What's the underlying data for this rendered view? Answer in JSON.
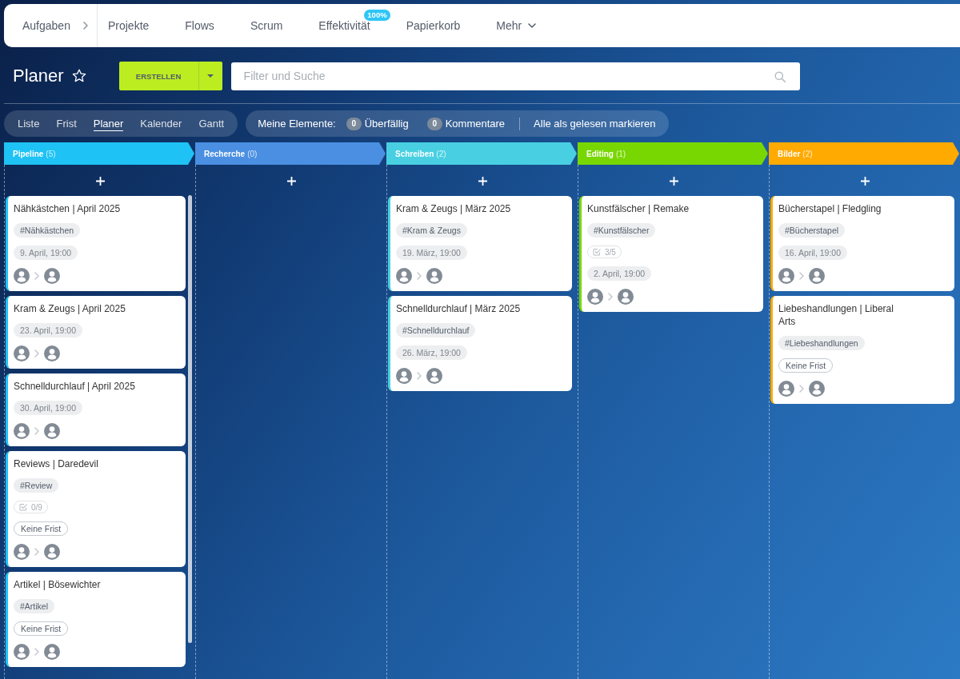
{
  "top_nav": {
    "items": [
      {
        "label": "Aufgaben",
        "kind": "section"
      },
      {
        "label": "Projekte",
        "kind": "link"
      },
      {
        "label": "Flows",
        "kind": "link"
      },
      {
        "label": "Scrum",
        "kind": "link"
      },
      {
        "label": "Effektivität",
        "kind": "link",
        "badge": "100%"
      },
      {
        "label": "Papierkorb",
        "kind": "link"
      },
      {
        "label": "Mehr",
        "kind": "menu"
      }
    ]
  },
  "header": {
    "title": "Planer",
    "favorite": false,
    "create_button": "ERSTELLEN",
    "search": {
      "placeholder": "Filter und Suche"
    }
  },
  "view_tabs": [
    {
      "label": "Liste",
      "selected": false
    },
    {
      "label": "Frist",
      "selected": false
    },
    {
      "label": "Planer",
      "selected": true
    },
    {
      "label": "Kalender",
      "selected": false
    },
    {
      "label": "Gantt",
      "selected": false
    }
  ],
  "counters_bar": {
    "label": "Meine Elemente:",
    "counters": [
      {
        "count": "0",
        "label": "Überfällig"
      },
      {
        "count": "0",
        "label": "Kommentare"
      }
    ],
    "action": "Alle als gelesen markieren"
  },
  "columns": [
    {
      "name": "Pipeline",
      "count": "(5)",
      "color": "#1ec2f4",
      "scrollable": true,
      "cards": [
        {
          "title": "Nähkästchen | April 2025",
          "tag": "#Nähkästchen",
          "deadline": {
            "kind": "date",
            "text": "9. April, 19:00"
          }
        },
        {
          "title": "Kram & Zeugs | April 2025",
          "deadline": {
            "kind": "date",
            "text": "23. April, 19:00"
          }
        },
        {
          "title": "Schnelldurchlauf | April 2025",
          "deadline": {
            "kind": "date",
            "text": "30. April, 19:00"
          }
        },
        {
          "title": "Reviews | Daredevil",
          "tag": "#Review",
          "checklist": "0/9",
          "deadline": {
            "kind": "none",
            "text": "Keine Frist"
          }
        },
        {
          "title": "Artikel | Bösewichter",
          "tag": "#Artikel",
          "deadline": {
            "kind": "none",
            "text": "Keine Frist"
          }
        }
      ]
    },
    {
      "name": "Recherche",
      "count": "(0)",
      "color": "#4a8fe2",
      "scrollable": false
    },
    {
      "name": "Schreiben",
      "count": "(2)",
      "color": "#48d0e2",
      "scrollable": false,
      "cards": [
        {
          "title": "Kram & Zeugs | März 2025",
          "tag": "#Kram & Zeugs",
          "deadline": {
            "kind": "date",
            "text": "19. März, 19:00"
          }
        },
        {
          "title": "Schnelldurchlauf | März 2025",
          "tag": "#Schnelldurchlauf",
          "deadline": {
            "kind": "date",
            "text": "26. März, 19:00"
          }
        }
      ]
    },
    {
      "name": "Editing",
      "count": "(1)",
      "color": "#78d700",
      "scrollable": false,
      "cards": [
        {
          "title": "Kunstfälscher | Remake",
          "tag": "#Kunstfälscher",
          "checklist": "3/5",
          "deadline": {
            "kind": "date",
            "text": "2. April, 19:00"
          }
        }
      ]
    },
    {
      "name": "Bilder",
      "count": "(2)",
      "color": "#ffaa00",
      "scrollable": false,
      "cards": [
        {
          "title": "Bücherstapel | Fledgling",
          "tag": "#Bücherstapel",
          "deadline": {
            "kind": "date",
            "text": "16. April, 19:00"
          }
        },
        {
          "title": "Liebeshandlungen | Liberal Arts",
          "tag": "#Liebeshandlungen",
          "deadline": {
            "kind": "none",
            "text": "Keine Frist"
          }
        }
      ]
    }
  ]
}
